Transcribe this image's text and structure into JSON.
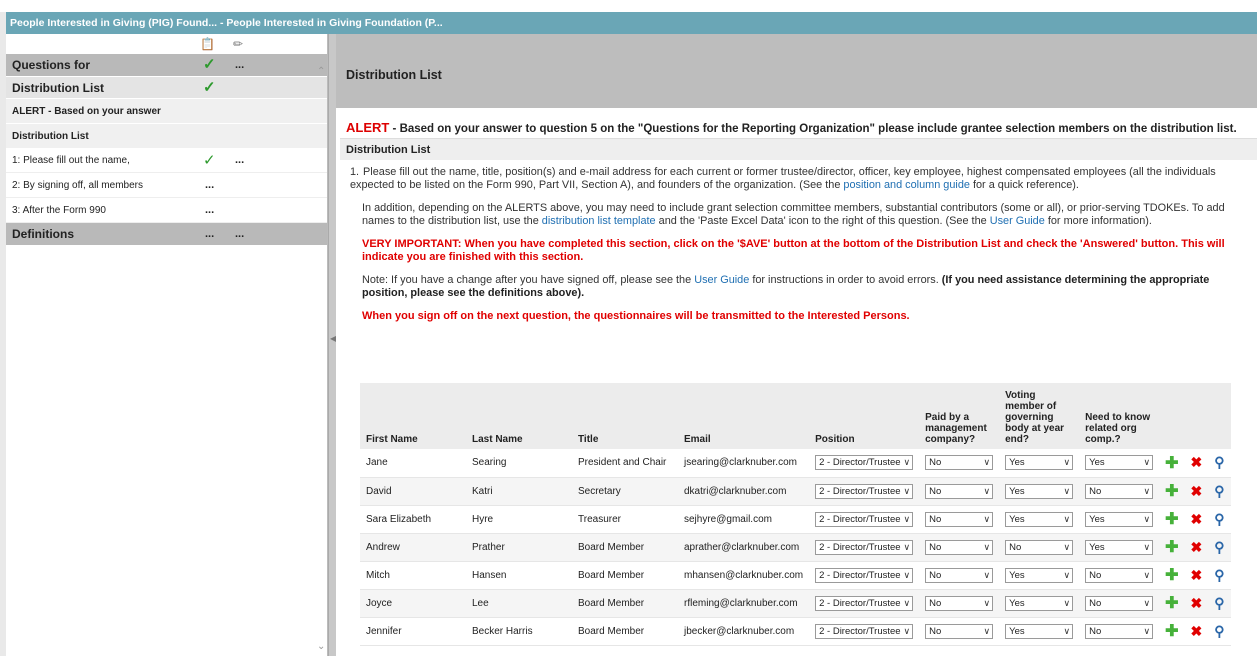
{
  "window": {
    "title": "People Interested in Giving (PIG) Found... - People Interested in Giving Foundation (P..."
  },
  "sidebar": {
    "items": [
      {
        "label": "Questions for",
        "checked": true,
        "dots": "..."
      },
      {
        "label": "Distribution List",
        "checked": true
      },
      {
        "label": "ALERT - Based on your answer"
      },
      {
        "label": "Distribution List"
      },
      {
        "label": "1: Please fill out the name,",
        "checked": true,
        "dots": "..."
      },
      {
        "label": "2: By signing off, all members",
        "dots": "..."
      },
      {
        "label": "3: After the Form 990",
        "dots": "..."
      },
      {
        "label": "Definitions",
        "dots1": "...",
        "dots2": "..."
      }
    ]
  },
  "main": {
    "header": "Distribution List",
    "alert_label": "ALERT",
    "alert_text": " - Based on your answer to question 5 on the \"Questions for the Reporting Organization\" please include grantee selection members on the distribution list.",
    "section_label": "Distribution List",
    "q_number": "1.",
    "p1_a": "Please fill out the name, title, position(s) and e-mail address for each current or former trustee/director, officer, key employee, highest compensated employees (all the individuals expected to be listed on the Form 990, Part VII, Section A), and founders of the organization. (See the ",
    "p1_link": "position and column guide",
    "p1_b": " for a quick reference).",
    "p2_a": "In addition, depending on the ALERTS above, you may need to include grant selection committee members, substantial contributors (some or all), or prior-serving TDOKEs. To add names to the distribution list, use the ",
    "p2_link1": "distribution list template",
    "p2_b": " and the 'Paste Excel Data' icon to the right of this question. (See the ",
    "p2_link2": "User Guide",
    "p2_c": " for more information).",
    "p3": "VERY IMPORTANT: When you have completed this section, click on the '$AVE' button at the bottom of the Distribution List and check the 'Answered' button. This will indicate you are finished with this section.",
    "p4_a": "Note: If you have a change after you have signed off, please see the ",
    "p4_link": "User Guide",
    "p4_b": " for instructions in order to avoid errors. ",
    "p4_bold": "(If you need assistance determining the appropriate position, please see the definitions above).",
    "p5": "When you sign off on the next question, the questionnaires will be transmitted to the Interested Persons."
  },
  "table": {
    "headers": {
      "first": "First Name",
      "last": "Last Name",
      "title": "Title",
      "email": "Email",
      "position": "Position",
      "paid": "Paid by a management company?",
      "voting": "Voting member of governing body at year end?",
      "need": "Need to know related org comp.?"
    },
    "rows": [
      {
        "first": "Jane",
        "last": "Searing",
        "title": "President and Chair",
        "email": "jsearing@clarknuber.com",
        "position": "2 - Director/Trustee",
        "paid": "No",
        "voting": "Yes",
        "need": "Yes"
      },
      {
        "first": "David",
        "last": "Katri",
        "title": "Secretary",
        "email": "dkatri@clarknuber.com",
        "position": "2 - Director/Trustee",
        "paid": "No",
        "voting": "Yes",
        "need": "No"
      },
      {
        "first": "Sara Elizabeth",
        "last": "Hyre",
        "title": "Treasurer",
        "email": "sejhyre@gmail.com",
        "position": "2 - Director/Trustee",
        "paid": "No",
        "voting": "Yes",
        "need": "Yes"
      },
      {
        "first": "Andrew",
        "last": "Prather",
        "title": "Board Member",
        "email": "aprather@clarknuber.com",
        "position": "2 - Director/Trustee",
        "paid": "No",
        "voting": "No",
        "need": "Yes"
      },
      {
        "first": "Mitch",
        "last": "Hansen",
        "title": "Board Member",
        "email": "mhansen@clarknuber.com",
        "position": "2 - Director/Trustee",
        "paid": "No",
        "voting": "Yes",
        "need": "No"
      },
      {
        "first": "Joyce",
        "last": "Lee",
        "title": "Board Member",
        "email": "rfleming@clarknuber.com",
        "position": "2 - Director/Trustee",
        "paid": "No",
        "voting": "Yes",
        "need": "No"
      },
      {
        "first": "Jennifer",
        "last": "Becker Harris",
        "title": "Board Member",
        "email": "jbecker@clarknuber.com",
        "position": "2 - Director/Trustee",
        "paid": "No",
        "voting": "Yes",
        "need": "No"
      }
    ]
  }
}
